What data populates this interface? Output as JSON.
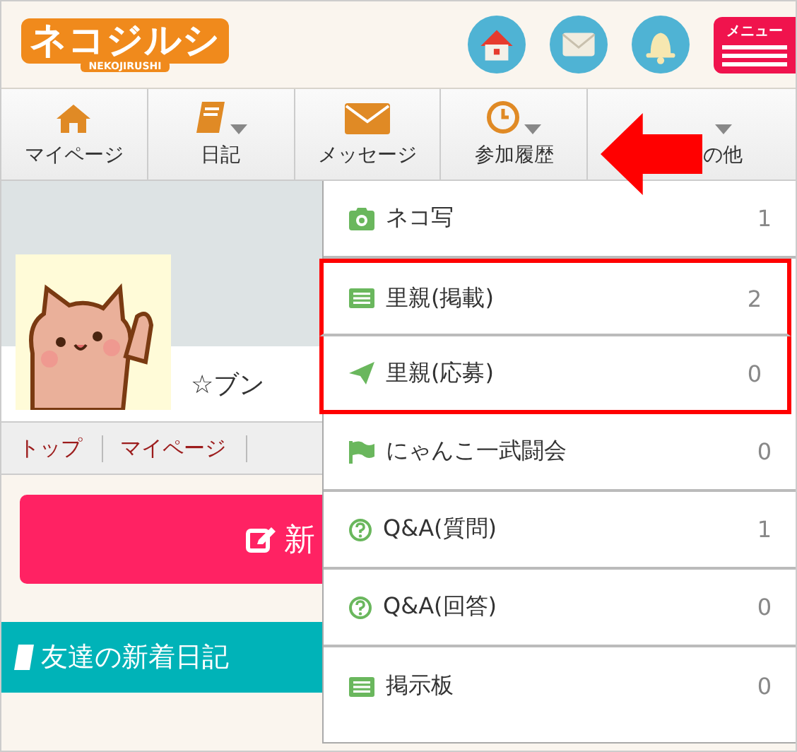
{
  "header": {
    "logo": "ネコジルシ",
    "logo_sub": "NEKOJIRUSHI",
    "menu_label": "メニュー"
  },
  "nav": [
    {
      "label": "マイページ",
      "kind": "home",
      "caret": false
    },
    {
      "label": "日記",
      "kind": "book",
      "caret": true
    },
    {
      "label": "メッセージ",
      "kind": "mail",
      "caret": false
    },
    {
      "label": "参加履歴",
      "kind": "clock",
      "caret": true
    },
    {
      "label": "の他",
      "kind": "other",
      "caret": true
    }
  ],
  "profile": {
    "name": "☆ブン"
  },
  "breadcrumb": [
    "トップ",
    "マイページ"
  ],
  "new_button": {
    "label": "新"
  },
  "section_title": "友達の新着日記",
  "dropdown": [
    {
      "kind": "camera",
      "label": "ネコ写",
      "count": "1",
      "highlighted": false
    },
    {
      "kind": "list",
      "label": "里親(掲載)",
      "count": "2",
      "highlighted": true
    },
    {
      "kind": "plane",
      "label": "里親(応募)",
      "count": "0",
      "highlighted": true
    },
    {
      "kind": "flag",
      "label": "にゃんこ一武闘会",
      "count": "0",
      "highlighted": false
    },
    {
      "kind": "question",
      "label": "Q&A(質問)",
      "count": "1",
      "highlighted": false
    },
    {
      "kind": "question",
      "label": "Q&A(回答)",
      "count": "0",
      "highlighted": false
    },
    {
      "kind": "list",
      "label": "掲示板",
      "count": "0",
      "highlighted": false
    }
  ]
}
